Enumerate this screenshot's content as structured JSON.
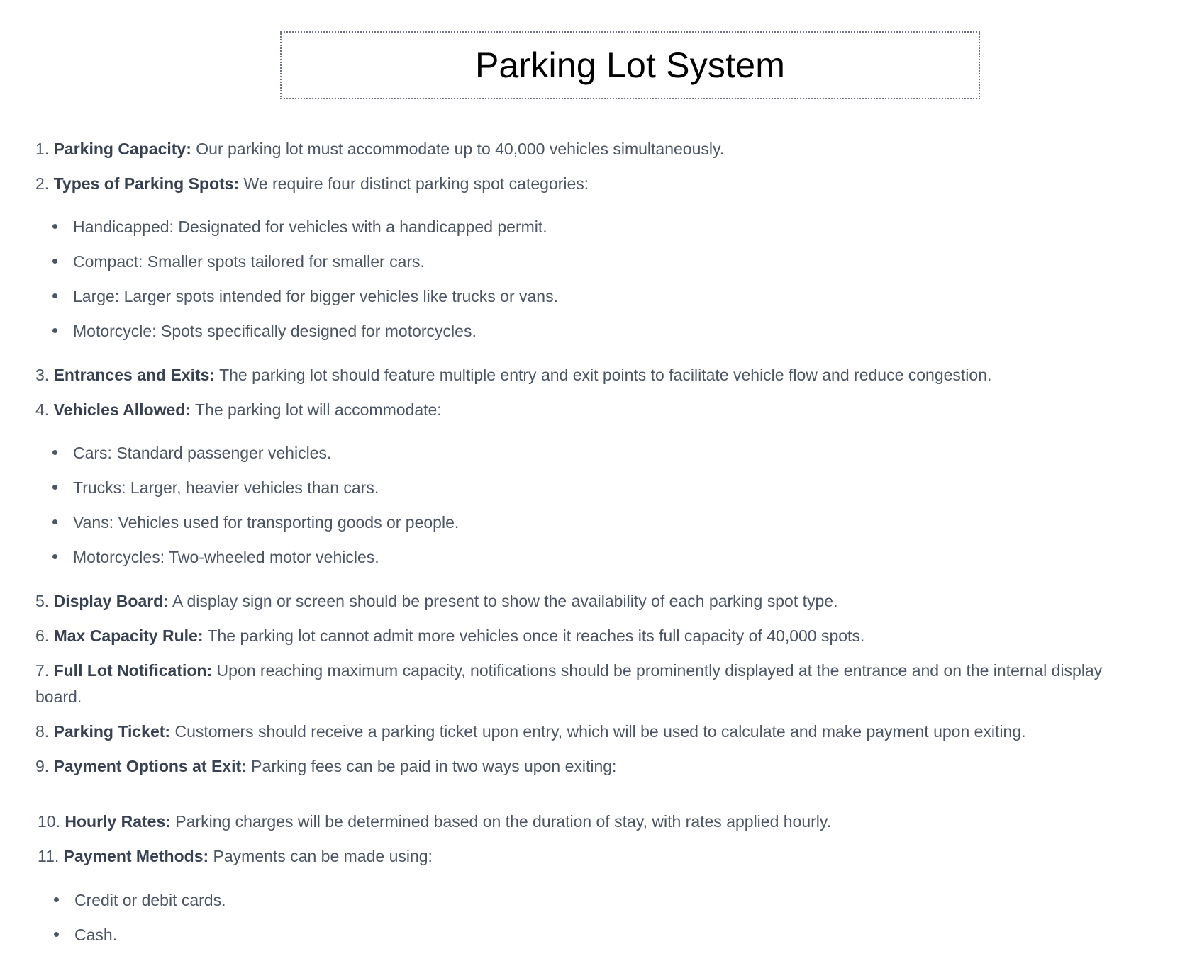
{
  "title": "Parking Lot System",
  "items": [
    {
      "num": "1.",
      "label": "Parking Capacity:",
      "text": " Our parking lot must accommodate up to 40,000 vehicles simultaneously."
    },
    {
      "num": "2.",
      "label": "Types of Parking Spots:",
      "text": " We require four distinct parking spot categories:"
    },
    {
      "num": "3.",
      "label": "Entrances and Exits:",
      "text": " The parking lot should feature multiple entry and exit points to facilitate vehicle flow and reduce congestion."
    },
    {
      "num": "4.",
      "label": "Vehicles Allowed:",
      "text": " The parking lot will accommodate:"
    },
    {
      "num": "5.",
      "label": "Display Board:",
      "text": " A display sign or screen should be present to show the availability of each parking spot type."
    },
    {
      "num": "6.",
      "label": "Max Capacity Rule:",
      "text": " The parking lot cannot admit more vehicles once it reaches its full capacity of 40,000 spots."
    },
    {
      "num": "7.",
      "label": "Full Lot Notification:",
      "text": " Upon reaching maximum capacity, notifications should be prominently displayed at the entrance and on the internal display board."
    },
    {
      "num": "8.",
      "label": "Parking Ticket:",
      "text": " Customers should receive a parking ticket upon entry, which will be used to calculate and make payment upon exiting."
    },
    {
      "num": "9.",
      "label": "Payment Options at Exit:",
      "text": " Parking fees can be paid in two ways upon exiting:"
    },
    {
      "num": "10.",
      "label": "Hourly Rates:",
      "text": " Parking charges will be determined based on the duration of stay, with rates applied hourly."
    },
    {
      "num": "11.",
      "label": "Payment Methods:",
      "text": " Payments can be made using:"
    }
  ],
  "spot_types": [
    "Handicapped: Designated for vehicles with a handicapped permit.",
    "Compact: Smaller spots tailored for smaller cars.",
    "Large: Larger spots intended for bigger vehicles like trucks or vans.",
    "Motorcycle: Spots specifically designed for motorcycles."
  ],
  "vehicles": [
    "Cars: Standard passenger vehicles.",
    "Trucks: Larger, heavier vehicles than cars.",
    "Vans: Vehicles used for transporting goods or people.",
    "Motorcycles: Two-wheeled motor vehicles."
  ],
  "payment_methods": [
    "Credit or debit cards.",
    "Cash."
  ]
}
